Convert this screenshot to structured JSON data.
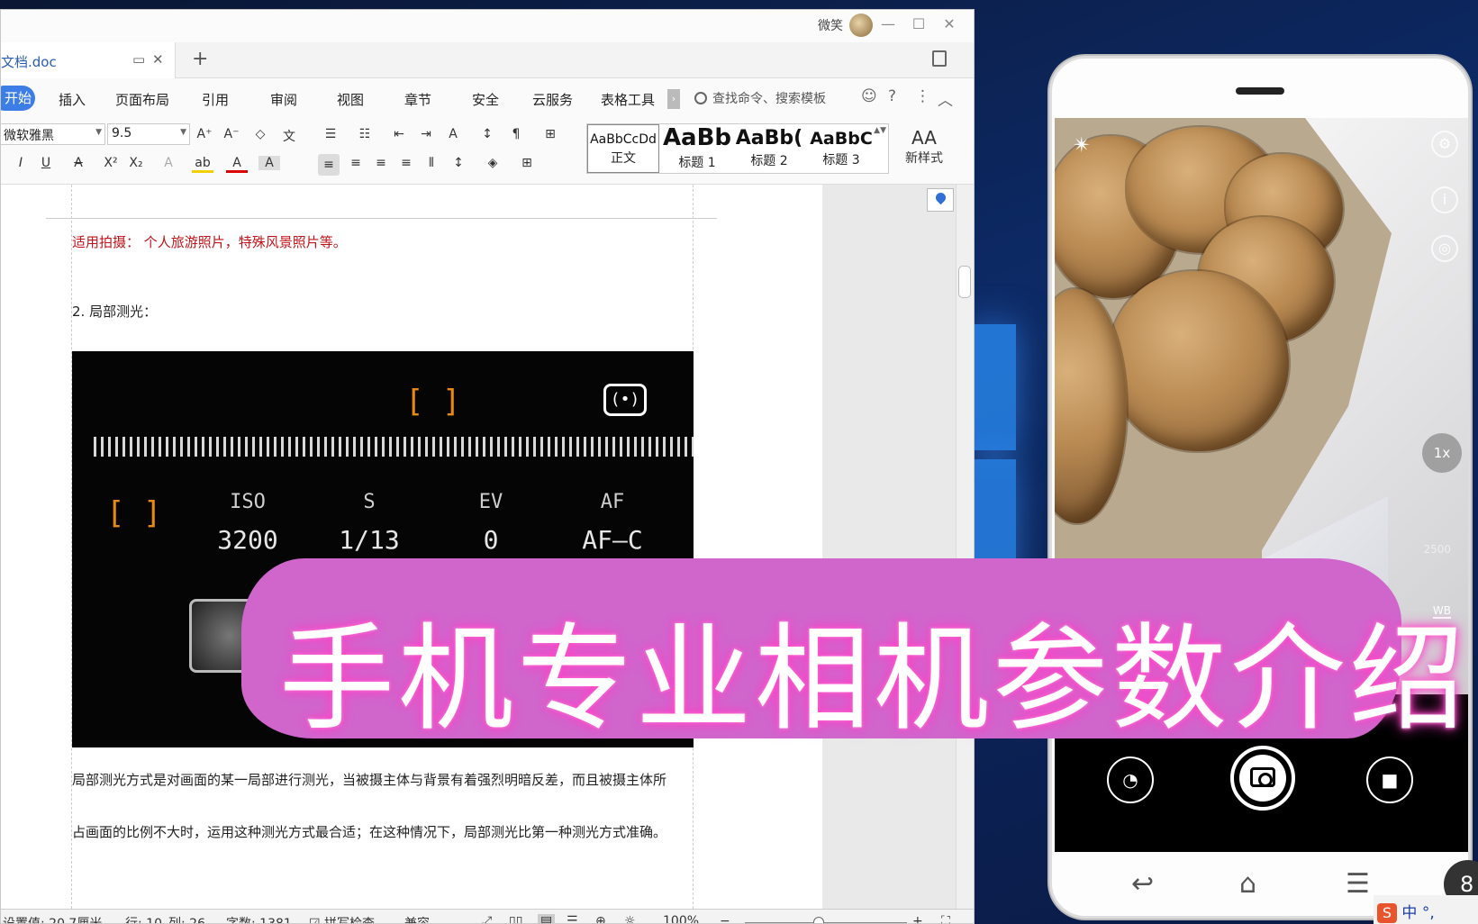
{
  "wps": {
    "titlebar": {
      "user_name": "微笑",
      "minimize": "—",
      "maximize": "☐",
      "close": "✕"
    },
    "doc_tab": {
      "title": "文档.doc",
      "new_tab": "+"
    },
    "menu": {
      "active": "开始",
      "items": [
        "插入",
        "页面布局",
        "引用",
        "审阅",
        "视图",
        "章节",
        "安全",
        "云服务",
        "表格工具"
      ],
      "search_placeholder": "查找命令、搜索模板"
    },
    "toolbar": {
      "font_name": "微软雅黑",
      "font_size": "9.5",
      "styles": [
        {
          "sample": "AaBbCcDd",
          "name": "正文"
        },
        {
          "sample": "AaBb",
          "name": "标题 1"
        },
        {
          "sample": "AaBb(",
          "name": "标题 2"
        },
        {
          "sample": "AaBbC",
          "name": "标题 3"
        }
      ],
      "new_style": "新样式"
    },
    "document": {
      "line1": "适用拍摄： 个人旅游照片，特殊风景照片等。",
      "line2": "2. 局部测光：",
      "line3": "局部测光方式是对画面的某一局部进行测光，当被摄主体与背景有着强烈明暗反差，而且被摄主体所",
      "line4": "占画面的比例不大时，运用这种测光方式最合适；在这种情况下，局部测光比第一种测光方式准确。",
      "photo": {
        "labels": [
          "ISO",
          "S",
          "EV",
          "AF"
        ],
        "values": [
          "3200",
          "1/13",
          "0",
          "AF—C"
        ]
      }
    },
    "statusbar": {
      "setting": "设置值: 20.7厘米",
      "row": "行: 10",
      "col": "列: 26",
      "words": "字数: 1381",
      "spell": "拼写检查",
      "compat": "兼容",
      "zoom": "100%"
    }
  },
  "phone": {
    "zoom_label": "1x",
    "wb_label": "WB",
    "value_2500": "2500"
  },
  "overlay_title": "手机专业相机参数介绍",
  "taskbar": {
    "ime": "中",
    "ime_extra": "°,",
    "clock_digit": "8"
  },
  "colors": {
    "accent": "#3c7de6",
    "overlay": "#d066cc",
    "doc_red": "#c0141a"
  }
}
